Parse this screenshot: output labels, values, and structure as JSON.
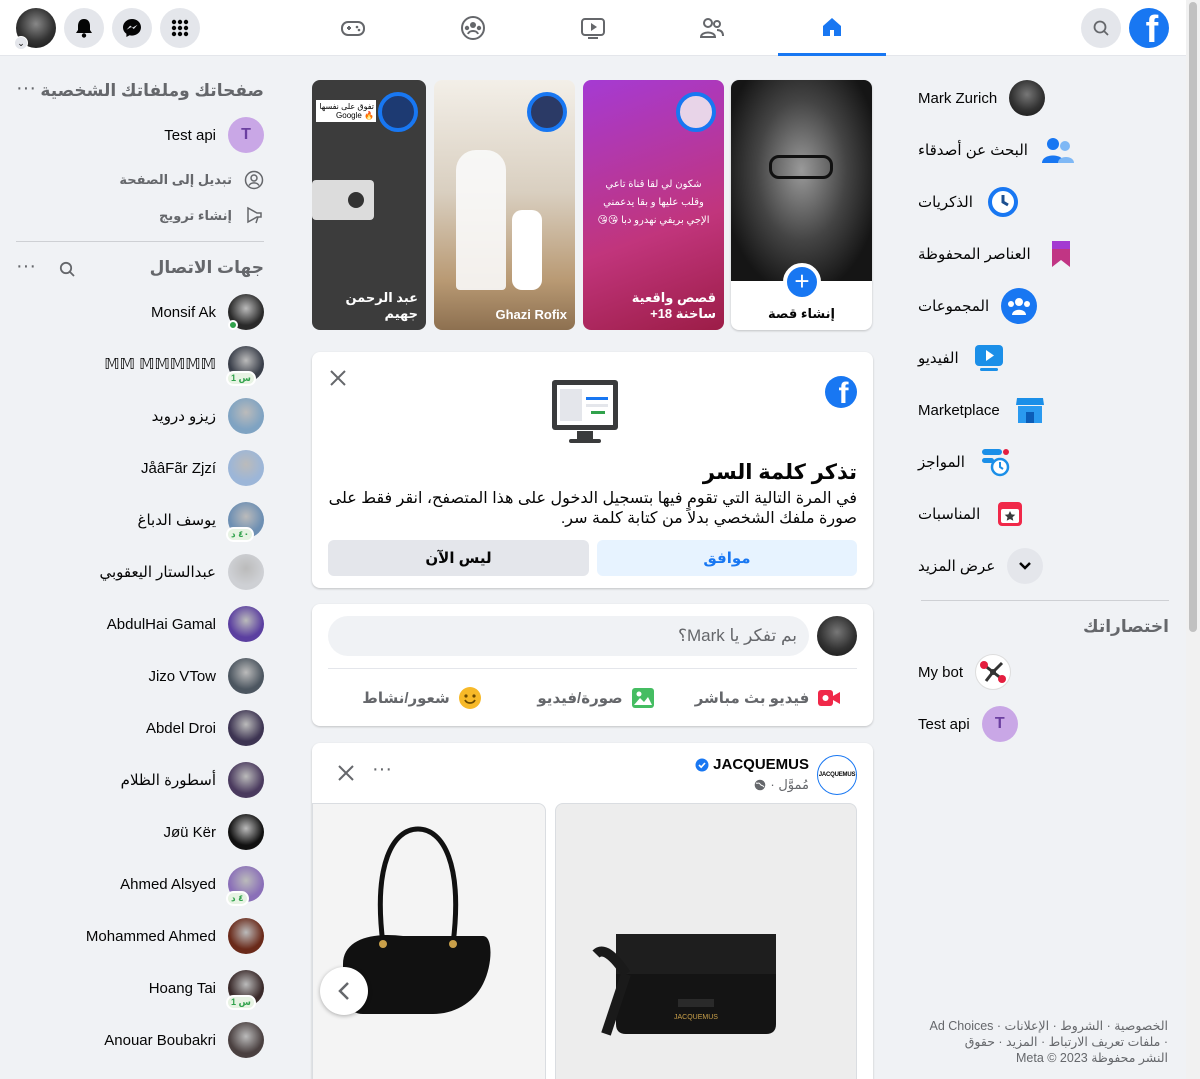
{
  "colors": {
    "accent": "#1877f2",
    "bg": "#f0f2f5",
    "secondary_text": "#65676b"
  },
  "topbar": {
    "tabs": [
      {
        "name": "home-icon",
        "active": true
      },
      {
        "name": "friends-icon",
        "active": false
      },
      {
        "name": "watch-icon",
        "active": false
      },
      {
        "name": "groups-icon",
        "active": false
      },
      {
        "name": "gaming-icon",
        "active": false
      }
    ],
    "left_icons": [
      "menu-grid-icon",
      "messenger-icon",
      "bell-icon",
      "account-avatar"
    ]
  },
  "right_nav": {
    "items": [
      {
        "label": "Mark Zurich",
        "icon": "profile-avatar"
      },
      {
        "label": "البحث عن أصدقاء",
        "icon": "friends-icon"
      },
      {
        "label": "الذكريات",
        "icon": "memories-clock-icon"
      },
      {
        "label": "العناصر المحفوظة",
        "icon": "bookmark-icon"
      },
      {
        "label": "المجموعات",
        "icon": "groups-icon"
      },
      {
        "label": "الفيديو",
        "icon": "video-icon"
      },
      {
        "label": "Marketplace",
        "icon": "marketplace-icon"
      },
      {
        "label": "المواجز",
        "icon": "feeds-icon"
      },
      {
        "label": "المناسبات",
        "icon": "events-icon"
      },
      {
        "label": "عرض المزيد",
        "icon": "chevron-down-icon"
      }
    ],
    "shortcuts_title": "اختصاراتك",
    "shortcuts": [
      {
        "label": "My bot"
      },
      {
        "label": "Test api",
        "initial": "T"
      }
    ]
  },
  "footer": {
    "line1": "الخصوصية · الشروط · الإعلانات · Ad Choices",
    "line2": "· ملفات تعريف الارتباط · المزيد · حقوق",
    "line3": "النشر محفوظة Meta © 2023"
  },
  "stories": [
    {
      "label": "إنشاء قصة",
      "type": "create"
    },
    {
      "label": "قصص واقعية ساخنة 18+",
      "text": "شكون لي لقا قناة تاعي وقلب عليها و بقا يدعمني الإجي بريفي نهدرو دبا 😘😘"
    },
    {
      "label": "Ghazi Rofix"
    },
    {
      "label": "عبد الرحمن جهيم",
      "caption": "تفوق على نفسها 🔥 Google"
    }
  ],
  "password_card": {
    "title": "تذكر كلمة السر",
    "body": "في المرة التالية التي تقوم فيها بتسجيل الدخول على هذا المتصفح، انقر فقط على صورة ملفك الشخصي بدلاً من كتابة كلمة سر.",
    "ok": "موافق",
    "not_now": "ليس الآن"
  },
  "composer": {
    "placeholder": "بم تفكر يا Mark؟",
    "live": "فيديو بث مباشر",
    "photo": "صورة/فيديو",
    "feeling": "شعور/نشاط"
  },
  "post": {
    "author": "JACQUEMUS",
    "sponsored": "مُموَّل ·",
    "logo_text": "JACQUEMUS",
    "product_label": "JACQUEMUS"
  },
  "left_panel": {
    "pages_title": "صفحاتك وملفاتك الشخصية",
    "page_name": "Test api",
    "page_initial": "T",
    "switch": "تبديل إلى الصفحة",
    "promote": "إنشاء ترويج",
    "contacts_title": "جهات الاتصال",
    "contacts": [
      {
        "name": "Monsif Ak",
        "online": true,
        "badge": "",
        "color": "#2a2a2a"
      },
      {
        "name": "𝕄𝕄 𝕄𝕄𝕄𝕄𝕄",
        "online": false,
        "badge": "1 س",
        "color": "#3a3f4a"
      },
      {
        "name": "زيزو درويد",
        "online": false,
        "badge": "",
        "color": "#7fa3c2"
      },
      {
        "name": "JåâFãr Zjzí",
        "online": false,
        "badge": "",
        "color": "#9cb6d8"
      },
      {
        "name": "يوسف الدباغ",
        "online": false,
        "badge": "٤٠ د",
        "color": "#6d8fb3"
      },
      {
        "name": "عبدالستار اليعقوبي",
        "online": false,
        "badge": "",
        "color": "#ced0d4"
      },
      {
        "name": "AbdulHai Gamal",
        "online": false,
        "badge": "",
        "color": "#5b3fa0"
      },
      {
        "name": "Jizo VTow",
        "online": false,
        "badge": "",
        "color": "#4c5660"
      },
      {
        "name": "Abdel Droi",
        "online": false,
        "badge": "",
        "color": "#3d3452"
      },
      {
        "name": "أسطورة الظلام",
        "online": false,
        "badge": "",
        "color": "#4a3a5e"
      },
      {
        "name": "Jøü Kër",
        "online": false,
        "badge": "",
        "color": "#111"
      },
      {
        "name": "Ahmed Alsyed",
        "online": false,
        "badge": "٤ د",
        "color": "#8a6fb8"
      },
      {
        "name": "Mohammed Ahmed",
        "online": false,
        "badge": "",
        "color": "#6a2a1a"
      },
      {
        "name": "Hoang Tai",
        "online": false,
        "badge": "1 س",
        "color": "#3a2a2a"
      },
      {
        "name": "Anouar Boubakri",
        "online": false,
        "badge": "",
        "color": "#4a4040"
      }
    ]
  }
}
